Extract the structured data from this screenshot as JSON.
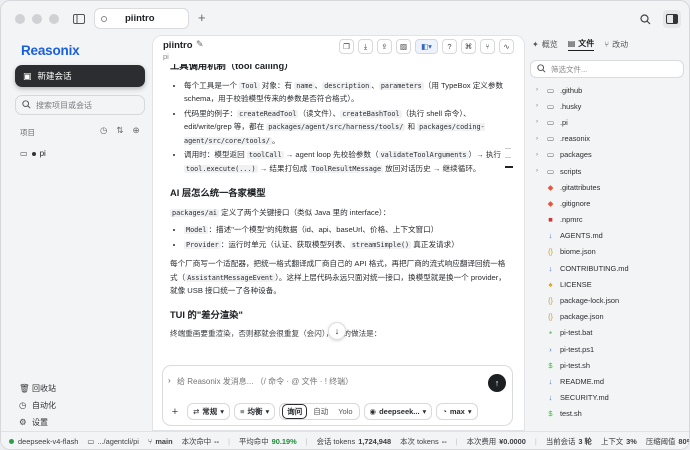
{
  "titlebar": {
    "tab_title": "piintro",
    "add_tab": "+"
  },
  "sidebar": {
    "logo": "Reasonix",
    "new_chat": "新建会话",
    "search_placeholder": "搜索项目或会话",
    "projects_label": "项目",
    "project_name": "pi",
    "bottom": [
      "回收站",
      "自动化",
      "设置"
    ]
  },
  "main": {
    "title": "piintro",
    "subtitle": "pi",
    "sections": {
      "tool_title": "工具调用机制（tool calling）",
      "tool_items": [
        {
          "pre": "每个工具是一个 ",
          "code1": "Tool",
          "mid1": " 对象：有 ",
          "code2": "name",
          "mid2": "、",
          "code3": "description",
          "mid3": "、",
          "code4": "parameters",
          "post": "（用 TypeBox 定义参数 schema，用于校验模型传来的参数是否符合格式）。"
        },
        {
          "pre": "代码里的例子：",
          "code1": "createReadTool",
          "mid1": "（读文件）、",
          "code2": "createBashTool",
          "mid2": "（执行 shell 命令）、edit/write/grep 等，都在 ",
          "code3": "packages/agent/src/harness/tools/",
          "mid3": " 和 ",
          "code4": "packages/coding-agent/src/core/tools/",
          "post": "。"
        },
        {
          "pre": "调用时：模型返回 ",
          "code1": "toolCall",
          "mid1": " → agent loop 先校验参数（",
          "code2": "validateToolArguments",
          "mid2": "）→ 执行 ",
          "code3": "tool.execute(...)",
          "mid3": " → 结果打包成 ",
          "code4": "ToolResultMessage",
          "post": " 放回对话历史 → 继续循环。"
        }
      ],
      "ai_title": "AI 层怎么统一各家模型",
      "ai_para_code": "packages/ai",
      "ai_para": " 定义了两个关键接口（类似 Java 里的 interface）：",
      "ai_items": [
        {
          "code": "Model",
          "text": "：描述\"一个模型\"的纯数据（id、api、baseUrl、价格、上下文窗口）"
        },
        {
          "code": "Provider",
          "text": "：运行时单元（认证、获取模型列表、",
          "code2": "streamSimple()",
          "text2": " 真正发请求）"
        }
      ],
      "adapter_para_pre": "每个厂商写一个适配器，把统一格式翻译成厂商自己的 API 格式，再把厂商的流式响应翻译回统一格式（",
      "adapter_code": "AssistantMessageEvent",
      "adapter_para_post": "）。这样上层代码永远只面对统一接口，换模型就是换一个 provider，就像 USB 接口统一了各种设备。",
      "tui_title": "TUI 的\"差分渲染\"",
      "tui_cut": "终端重画要重渲染，否则都就会很重复（会闪），tui 的做法是："
    },
    "composer": {
      "placeholder": "给 Reasonix 发消息... （/ 命令 · @ 文件 · ! 终端）",
      "mode_normal": "常规",
      "effort": "均衡",
      "modes": [
        "询问",
        "自动",
        "Yolo"
      ],
      "model": "deepseek...",
      "level": "max"
    }
  },
  "right": {
    "tabs": [
      "概览",
      "文件",
      "改动"
    ],
    "search_placeholder": "筛选文件...",
    "files": [
      {
        "name": ".github",
        "type": "folder"
      },
      {
        "name": ".husky",
        "type": "folder"
      },
      {
        "name": ".pi",
        "type": "folder"
      },
      {
        "name": ".reasonix",
        "type": "folder"
      },
      {
        "name": "packages",
        "type": "folder"
      },
      {
        "name": "scripts",
        "type": "folder"
      },
      {
        "name": ".gitattributes",
        "type": "git"
      },
      {
        "name": ".gitignore",
        "type": "git"
      },
      {
        "name": ".npmrc",
        "type": "npm"
      },
      {
        "name": "AGENTS.md",
        "type": "md"
      },
      {
        "name": "biome.json",
        "type": "json"
      },
      {
        "name": "CONTRIBUTING.md",
        "type": "md"
      },
      {
        "name": "LICENSE",
        "type": "license"
      },
      {
        "name": "package-lock.json",
        "type": "json"
      },
      {
        "name": "package.json",
        "type": "json"
      },
      {
        "name": "pi-test.bat",
        "type": "bat"
      },
      {
        "name": "pi-test.ps1",
        "type": "ps"
      },
      {
        "name": "pi-test.sh",
        "type": "sh"
      },
      {
        "name": "README.md",
        "type": "md"
      },
      {
        "name": "SECURITY.md",
        "type": "md"
      },
      {
        "name": "test.sh",
        "type": "sh"
      }
    ]
  },
  "status": {
    "model": "deepseek-v4-flash",
    "path": ".../agentcli/pi",
    "branch": "main",
    "session_cache_label": "本次命中",
    "session_cache_value": "--",
    "avg_cache_label": "平均命中",
    "avg_cache_value": "90.19%",
    "session_tokens_label": "会话 tokens",
    "session_tokens_value": "1,724,948",
    "this_tokens_label": "本次 tokens",
    "this_tokens_value": "--",
    "cost_label": "本次费用",
    "cost_value": "¥0.0000",
    "turn_label": "当前会话",
    "turn_value": "3 轮",
    "context_label": "上下文",
    "context_value": "3%",
    "compress_label": "压缩阈值",
    "compress_value": "80%"
  },
  "colors": {
    "accent": "#1a5fd9",
    "success": "#1e8c3a",
    "dark_button": "#2b2d31"
  }
}
